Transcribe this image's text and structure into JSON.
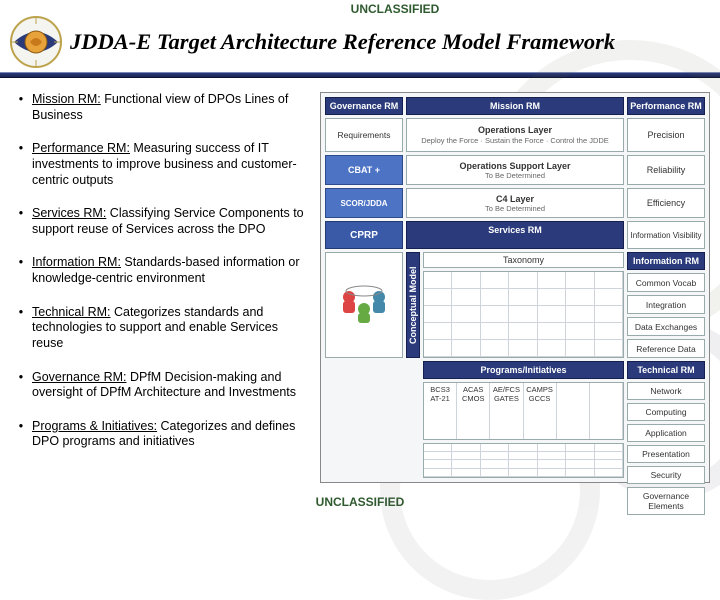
{
  "classification": "UNCLASSIFIED",
  "title": "JDDA-E Target Architecture Reference Model Framework",
  "bullets": [
    {
      "title": "Mission RM:",
      "text": "  Functional view of DPOs Lines of Business"
    },
    {
      "title": "Performance RM:",
      "text": "  Measuring success of IT investments to improve business and customer-centric outputs"
    },
    {
      "title": "Services RM:",
      "text": "  Classifying Service Components to support reuse of Services across the DPO"
    },
    {
      "title": "Information RM:",
      "text": "  Standards-based information or knowledge-centric environment"
    },
    {
      "title": "Technical RM:",
      "text": "  Categorizes standards and technologies to support and enable Services reuse"
    },
    {
      "title": "Governance RM:",
      "text": "  DPfM Decision-making and oversight of DPfM Architecture and Investments"
    },
    {
      "title": "Programs & Initiatives:",
      "text": "  Categorizes and defines DPO programs and initiatives"
    }
  ],
  "diagram": {
    "left_header": "Governance RM",
    "mid_header": "Mission RM",
    "right_header": "Performance RM",
    "requirements": "Requirements",
    "cbat": "CBAT +",
    "scor": "SCOR/JDDA",
    "cprp": "CPRP",
    "ops_layer_title": "Operations Layer",
    "ops_layer_sub": "Deploy the Force · Sustain the Force · Control the JDDE",
    "ops_support_title": "Operations Support Layer",
    "ops_support_sub": "To Be Determined",
    "c4_title": "C4 Layer",
    "c4_sub": "To Be Determined",
    "perf": [
      "Precision",
      "Reliability",
      "Efficiency",
      "Information Visibility"
    ],
    "services_header": "Services RM",
    "taxonomy": "Taxonomy",
    "info_header": "Information RM",
    "info_cells": [
      "Common Vocab",
      "Integration",
      "Data Exchanges",
      "Reference Data"
    ],
    "conceptual_label": "Conceptual Model",
    "programs_header": "Programs/Initiatives",
    "programs": [
      "BCS3\nAT-21",
      "ACAS\nCMOS",
      "AE/FCS\nGATES",
      "CAMPS\nGCCS",
      "",
      ""
    ],
    "tech_header": "Technical RM",
    "tech_cells": [
      "Network",
      "Computing",
      "Application",
      "Presentation",
      "Security",
      "Governance Elements"
    ]
  }
}
